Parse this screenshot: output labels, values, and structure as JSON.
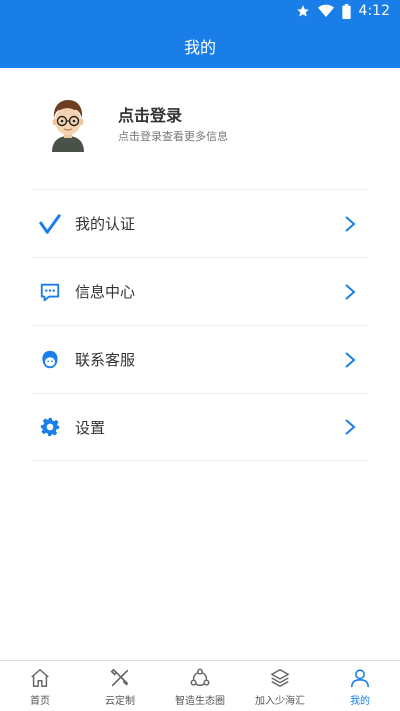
{
  "status_bar": {
    "time": "4:12",
    "icons": [
      "star-icon",
      "wifi-icon",
      "battery-icon"
    ]
  },
  "app_bar": {
    "title": "我的"
  },
  "profile": {
    "title": "点击登录",
    "subtitle": "点击登录查看更多信息",
    "avatar_icon": "avatar-cartoon-icon"
  },
  "menu": {
    "items": [
      {
        "label": "我的认证",
        "icon": "check-icon"
      },
      {
        "label": "信息中心",
        "icon": "message-icon"
      },
      {
        "label": "联系客服",
        "icon": "support-icon"
      },
      {
        "label": "设置",
        "icon": "gear-icon"
      }
    ]
  },
  "tab_bar": {
    "tabs": [
      {
        "label": "首页",
        "icon": "home-icon",
        "active": false
      },
      {
        "label": "云定制",
        "icon": "tools-icon",
        "active": false
      },
      {
        "label": "智造生态圈",
        "icon": "ecosystem-icon",
        "active": false
      },
      {
        "label": "加入少海汇",
        "icon": "layers-icon",
        "active": false
      },
      {
        "label": "我的",
        "icon": "user-icon",
        "active": true
      }
    ]
  },
  "colors": {
    "primary": "#1a7ee8",
    "text": "#333333",
    "subtext": "#777777",
    "divider": "#eeeeee"
  }
}
